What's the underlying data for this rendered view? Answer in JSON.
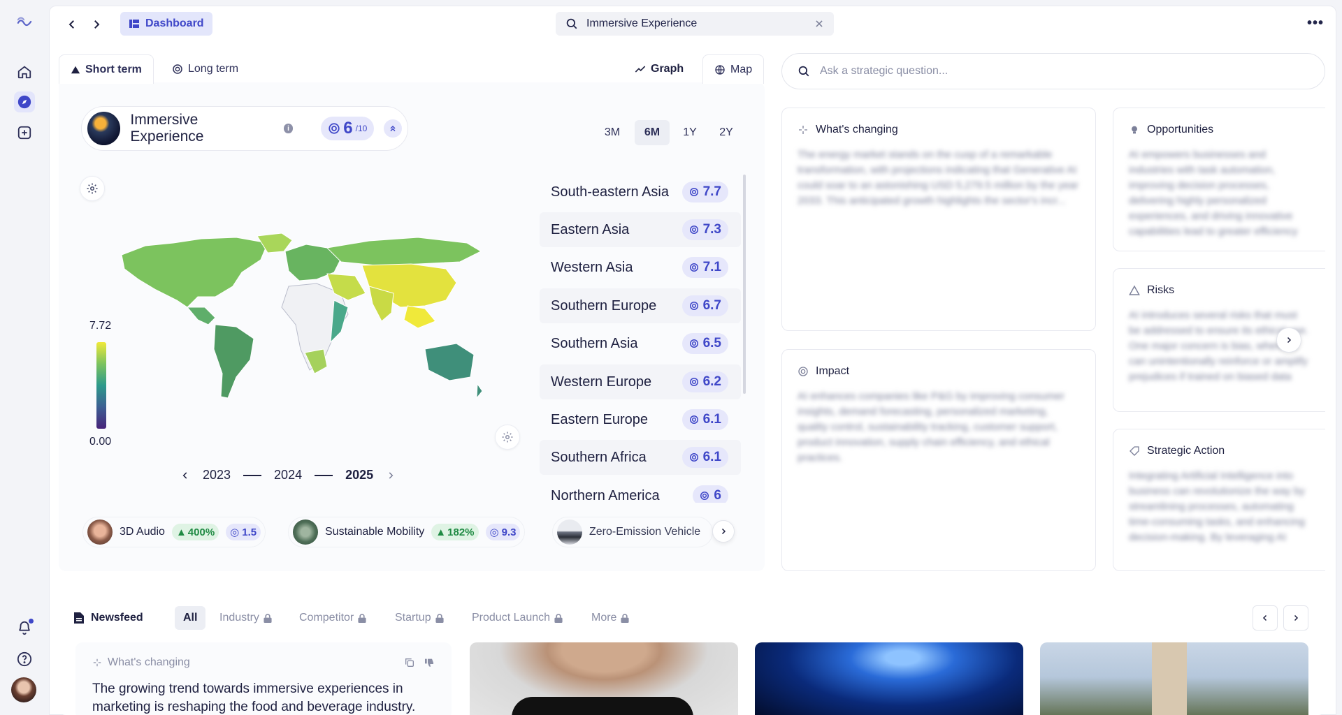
{
  "breadcrumb": {
    "dashboard": "Dashboard"
  },
  "search": {
    "value": "Immersive Experience"
  },
  "tabs": {
    "short_term": "Short term",
    "long_term": "Long term",
    "graph": "Graph",
    "map": "Map"
  },
  "trend": {
    "name": "Immersive Experience",
    "score": "6",
    "score_max": "/10"
  },
  "ranges": [
    "3M",
    "6M",
    "1Y",
    "2Y"
  ],
  "active_range": "6M",
  "legend": {
    "max": "7.72",
    "min": "0.00"
  },
  "years": [
    "2023",
    "2024",
    "2025"
  ],
  "active_year": "2025",
  "regions": [
    {
      "name": "South-eastern Asia",
      "score": "7.7"
    },
    {
      "name": "Eastern Asia",
      "score": "7.3"
    },
    {
      "name": "Western Asia",
      "score": "7.1"
    },
    {
      "name": "Southern Europe",
      "score": "6.7"
    },
    {
      "name": "Southern Asia",
      "score": "6.5"
    },
    {
      "name": "Western Europe",
      "score": "6.2"
    },
    {
      "name": "Eastern Europe",
      "score": "6.1"
    },
    {
      "name": "Southern Africa",
      "score": "6.1"
    },
    {
      "name": "Northern America",
      "score": "6"
    }
  ],
  "related": [
    {
      "name": "3D Audio",
      "growth": "400%",
      "score": "1.5"
    },
    {
      "name": "Sustainable Mobility",
      "growth": "182%",
      "score": "9.3"
    },
    {
      "name": "Zero-Emission Vehicle",
      "growth": "",
      "score": ""
    }
  ],
  "ask": {
    "placeholder": "Ask a strategic question..."
  },
  "cards": {
    "whats_changing": {
      "title": "What's changing",
      "body": "The energy market stands on the cusp of a remarkable transformation, with projections indicating that Generative AI could soar to an astonishing USD 5,279.5 million by the year 2033. This anticipated growth highlights the sector's incr..."
    },
    "impact": {
      "title": "Impact",
      "body": "AI enhances companies like P&G by improving consumer insights, demand forecasting, personalized marketing, quality control, sustainability tracking, customer support, product innovation, supply chain efficiency, and ethical practices."
    },
    "opportunities": {
      "title": "Opportunities",
      "body": "AI empowers businesses and industries with task automation, improving decision processes, delivering highly personalized experiences, and driving innovative capabilities lead to greater efficiency"
    },
    "risks": {
      "title": "Risks",
      "body": "AI introduces several risks that must be addressed to ensure its ethical use. One major concern is bias, where AI can unintentionally reinforce or amplify prejudices if trained on biased data"
    },
    "strategic_action": {
      "title": "Strategic Action",
      "body": "Integrating Artificial Intelligence into business can revolutionize the way by streamlining processes, automating time-consuming tasks, and enhancing decision-making. By leveraging AI"
    }
  },
  "newsfeed": {
    "title": "Newsfeed",
    "tabs": [
      "All",
      "Industry",
      "Competitor",
      "Startup",
      "Product Launch",
      "More"
    ],
    "card_tag": "What's changing",
    "card_text": "The growing trend towards immersive experiences in marketing is reshaping the food and beverage industry."
  },
  "colors": {
    "accent": "#3f47c8",
    "accent_soft": "#e6e7fb",
    "growth": "#1f8a43"
  }
}
